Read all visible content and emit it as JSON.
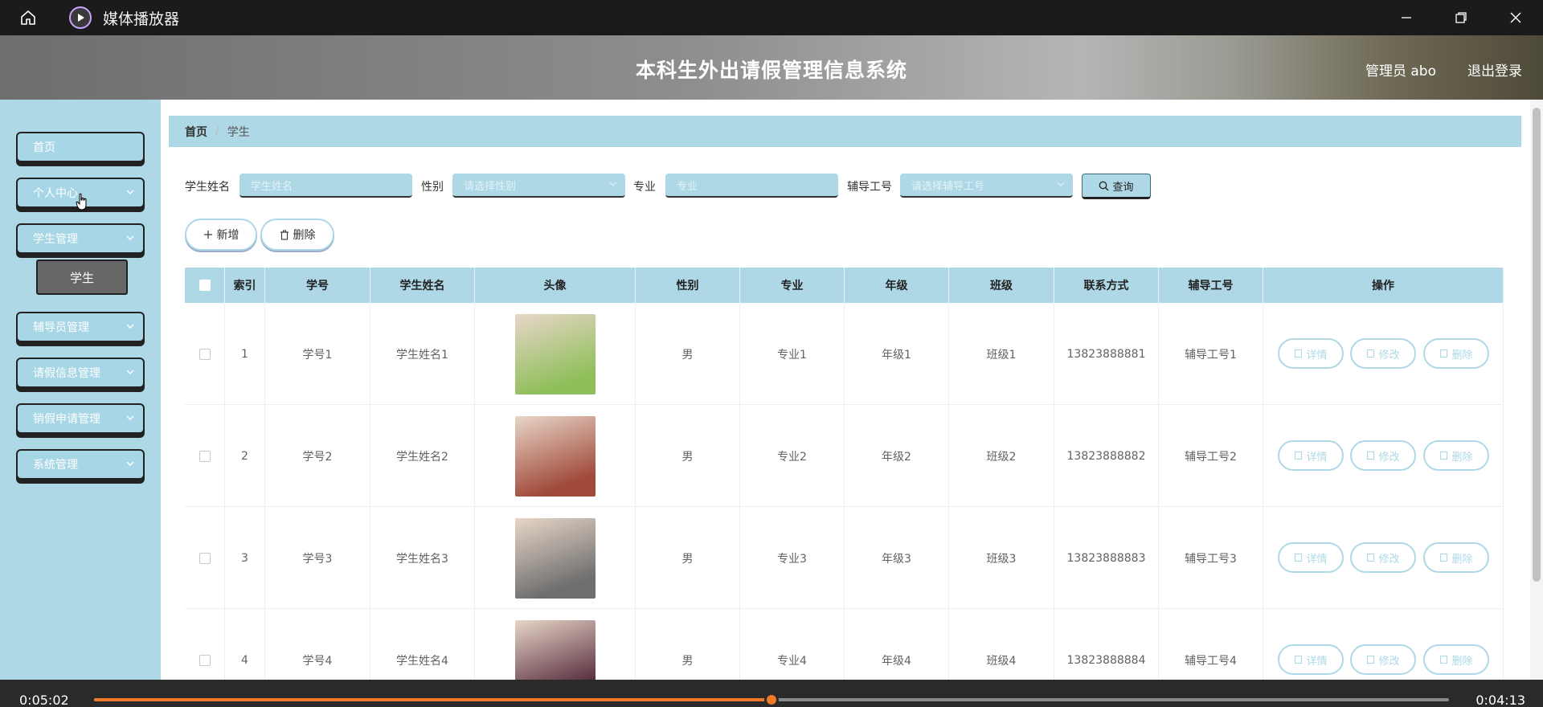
{
  "player": {
    "title": "媒体播放器",
    "current_time": "0:05:02",
    "remaining_time": "0:04:13",
    "progress": 0.5,
    "accent": "#f07a2a"
  },
  "header": {
    "title": "本科生外出请假管理信息系统",
    "user": "管理员 abo",
    "logout": "退出登录"
  },
  "sidebar": {
    "items": [
      {
        "label": "首页",
        "chevron": false
      },
      {
        "label": "个人中心",
        "chevron": true
      },
      {
        "label": "学生管理",
        "chevron": true
      },
      {
        "label": "辅导员管理",
        "chevron": true
      },
      {
        "label": "请假信息管理",
        "chevron": true
      },
      {
        "label": "销假申请管理",
        "chevron": true
      },
      {
        "label": "系统管理",
        "chevron": true
      }
    ],
    "sub_item": "学生"
  },
  "breadcrumb": {
    "home": "首页",
    "separator": "/",
    "current": "学生"
  },
  "search": {
    "name_label": "学生姓名",
    "name_placeholder": "学生姓名",
    "gender_label": "性别",
    "gender_placeholder": "请选择性别",
    "major_label": "专业",
    "major_placeholder": "专业",
    "tutor_label": "辅导工号",
    "tutor_placeholder": "请选择辅导工号",
    "query_button": "查询"
  },
  "actions": {
    "add": "新增",
    "delete": "删除"
  },
  "table": {
    "headers": [
      "索引",
      "学号",
      "学生姓名",
      "头像",
      "性别",
      "专业",
      "年级",
      "班级",
      "联系方式",
      "辅导工号",
      "操作"
    ],
    "op_labels": {
      "detail": "详情",
      "edit": "修改",
      "delete": "删除"
    },
    "rows": [
      {
        "index": "1",
        "sno": "学号1",
        "name": "学生姓名1",
        "gender": "男",
        "major": "专业1",
        "grade": "年级1",
        "class": "班级1",
        "phone": "13823888881",
        "tutor": "辅导工号1",
        "avatar_color": "#8fbf5a"
      },
      {
        "index": "2",
        "sno": "学号2",
        "name": "学生姓名2",
        "gender": "男",
        "major": "专业2",
        "grade": "年级2",
        "class": "班级2",
        "phone": "13823888882",
        "tutor": "辅导工号2",
        "avatar_color": "#a04a3a"
      },
      {
        "index": "3",
        "sno": "学号3",
        "name": "学生姓名3",
        "gender": "男",
        "major": "专业3",
        "grade": "年级3",
        "class": "班级3",
        "phone": "13823888883",
        "tutor": "辅导工号3",
        "avatar_color": "#6e6e6e"
      },
      {
        "index": "4",
        "sno": "学号4",
        "name": "学生姓名4",
        "gender": "男",
        "major": "专业4",
        "grade": "年级4",
        "class": "班级4",
        "phone": "13823888884",
        "tutor": "辅导工号4",
        "avatar_color": "#5a3040"
      }
    ]
  },
  "colors": {
    "theme": "#aed8e6",
    "sidebar_sub": "#676767"
  }
}
